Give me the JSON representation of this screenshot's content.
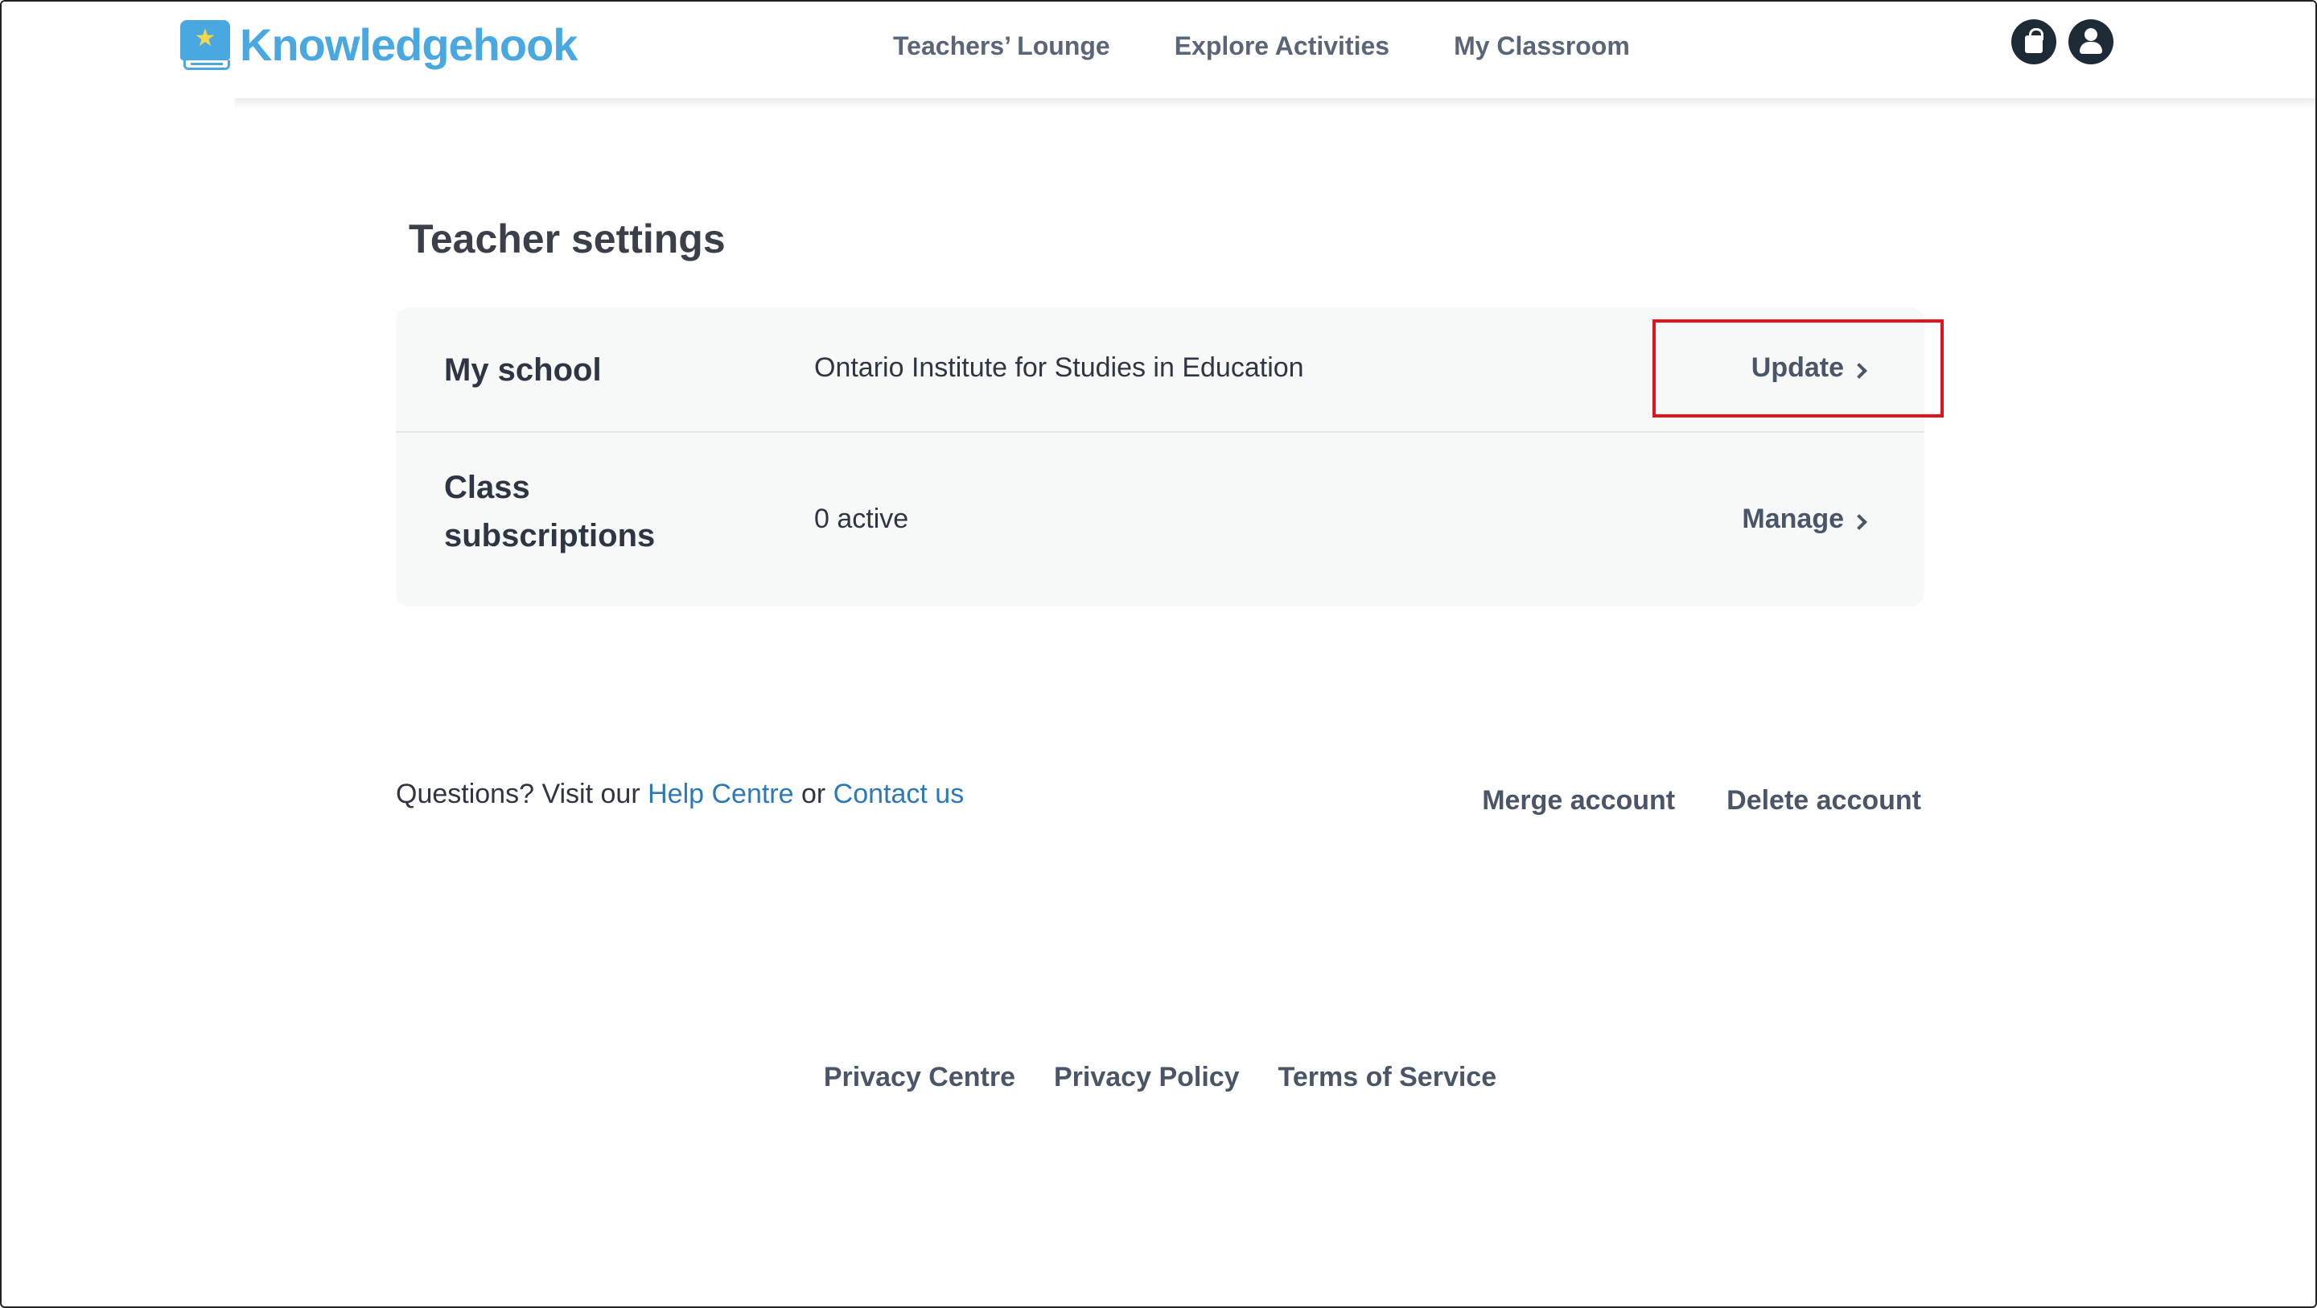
{
  "header": {
    "logo_text": "Knowledgehook",
    "nav": [
      "Teachers’ Lounge",
      "Explore Activities",
      "My Classroom"
    ],
    "icons": [
      "shopping-bag-icon",
      "user-account-icon"
    ]
  },
  "main": {
    "title": "Teacher settings",
    "rows": [
      {
        "label": "My school",
        "value": "Ontario Institute for Studies in Education",
        "action": "Update"
      },
      {
        "label": "Class subscriptions",
        "value": "0 active",
        "action": "Manage"
      }
    ]
  },
  "help": {
    "prefix": "Questions? Visit our",
    "help_link": "Help Centre",
    "or": "or",
    "contact_link": "Contact us"
  },
  "account_links": [
    "Merge account",
    "Delete account"
  ],
  "footer": [
    "Privacy Centre",
    "Privacy Policy",
    "Terms of Service"
  ],
  "colors": {
    "brand": "#4aa8e0",
    "link": "#2c78b8",
    "highlight": "#e0141e"
  }
}
